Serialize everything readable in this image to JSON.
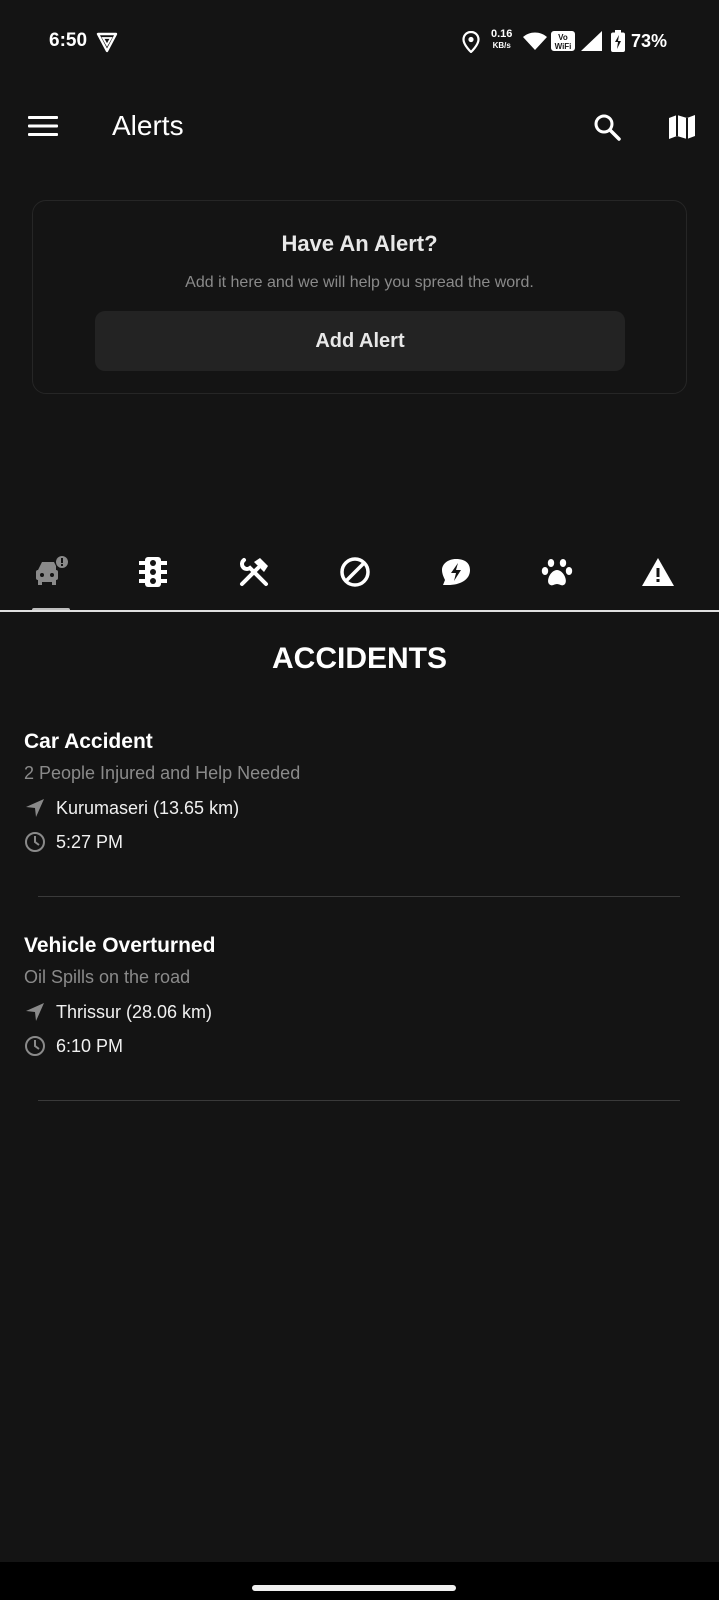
{
  "status_bar": {
    "time": "6:50",
    "speed_value": "0.16",
    "speed_unit": "KB/s",
    "vowifi_line1": "Vo",
    "vowifi_line2": "WiFi",
    "battery_percent": "73%"
  },
  "app_bar": {
    "title": "Alerts"
  },
  "card": {
    "title": "Have An Alert?",
    "subtitle": "Add it here and we will help you spread the word.",
    "button_label": "Add Alert"
  },
  "tabs": [
    {
      "icon": "car-alert-icon",
      "selected": true
    },
    {
      "icon": "traffic-light-icon",
      "selected": false
    },
    {
      "icon": "tools-icon",
      "selected": false
    },
    {
      "icon": "block-icon",
      "selected": false
    },
    {
      "icon": "power-leaf-icon",
      "selected": false
    },
    {
      "icon": "paw-icon",
      "selected": false
    },
    {
      "icon": "warning-icon",
      "selected": false
    }
  ],
  "section": {
    "title": "ACCIDENTS"
  },
  "alerts": [
    {
      "title": "Car Accident",
      "description": "2 People Injured and Help Needed",
      "location": "Kurumaseri (13.65 km)",
      "time": "5:27 PM"
    },
    {
      "title": "Vehicle Overturned",
      "description": "Oil Spills on the road",
      "location": "Thrissur (28.06 km)",
      "time": "6:10 PM"
    }
  ],
  "colors": {
    "background": "#141414",
    "card_button": "#232323",
    "muted_text": "#8a8a8a"
  }
}
